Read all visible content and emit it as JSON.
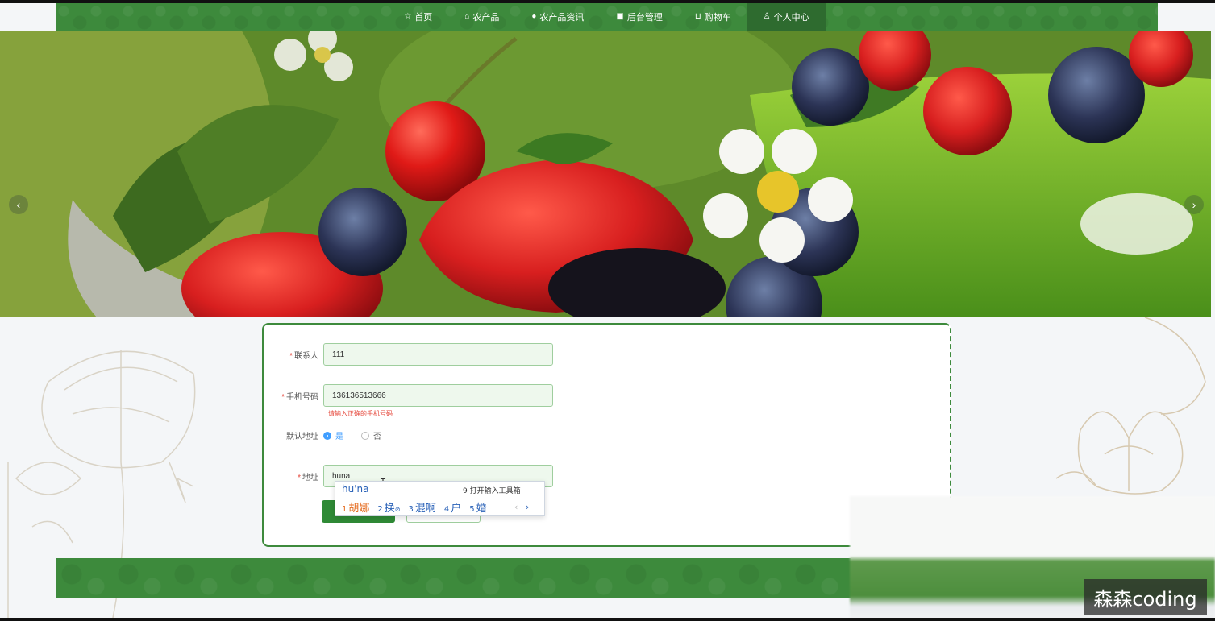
{
  "nav": {
    "items": [
      {
        "icon": "star-icon",
        "glyph": "☆",
        "label": "首页"
      },
      {
        "icon": "bag-icon",
        "glyph": "⌂",
        "label": "农产品"
      },
      {
        "icon": "info-icon",
        "glyph": "●",
        "label": "农产品资讯"
      },
      {
        "icon": "briefcase-icon",
        "glyph": "▣",
        "label": "后台管理"
      },
      {
        "icon": "cart-icon",
        "glyph": "⊔",
        "label": "购物车"
      },
      {
        "icon": "user-icon",
        "glyph": "♙",
        "label": "个人中心"
      }
    ],
    "active_index": 5
  },
  "carousel": {
    "prev_glyph": "‹",
    "next_glyph": "›",
    "slide_count": 3,
    "active_slide": 0
  },
  "form": {
    "contact": {
      "label": "联系人",
      "value": "111"
    },
    "phone": {
      "label": "手机号码",
      "value": "136136513666",
      "error": "请输入正确的手机号码"
    },
    "default_address": {
      "label": "默认地址",
      "options": [
        "是",
        "否"
      ],
      "selected": "是"
    },
    "address": {
      "label": "地址",
      "value": "huna"
    }
  },
  "ime": {
    "composition": "hu'na",
    "toolbox": "9 打开输入工具箱",
    "candidates": [
      {
        "n": "1",
        "text": "胡娜"
      },
      {
        "n": "2",
        "text": "换"
      },
      {
        "n": "3",
        "text": "混啊"
      },
      {
        "n": "4",
        "text": "户"
      },
      {
        "n": "5",
        "text": "婚"
      }
    ],
    "prev": "‹",
    "next": "›"
  },
  "watermark": "森森coding"
}
